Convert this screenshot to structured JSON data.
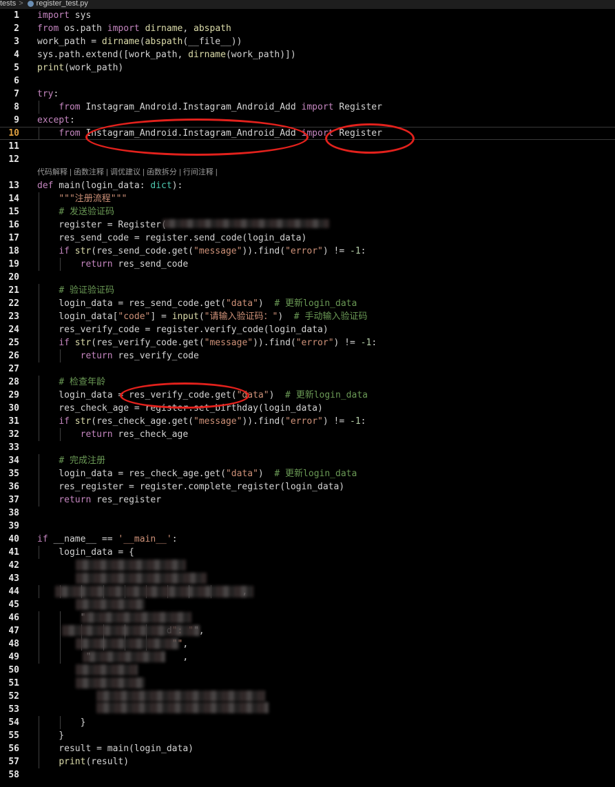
{
  "breadcrumb": {
    "folder": "tests",
    "separator": ">",
    "file": "register_test.py"
  },
  "codelens": "代码解释 | 函数注释 | 调优建议 | 函数拆分 | 行间注释 | ",
  "current_line": 10,
  "lines": [
    {
      "n": "1",
      "code": "import sys"
    },
    {
      "n": "2",
      "code": "from os.path import dirname, abspath"
    },
    {
      "n": "3",
      "code": "work_path = dirname(abspath(__file__))"
    },
    {
      "n": "4",
      "code": "sys.path.extend([work_path, dirname(work_path)])"
    },
    {
      "n": "5",
      "code": "print(work_path)"
    },
    {
      "n": "6",
      "code": ""
    },
    {
      "n": "7",
      "code": "try:"
    },
    {
      "n": "8",
      "code": "    from Instagram_Android.Instagram_Android_Add import Register"
    },
    {
      "n": "9",
      "code": "except:"
    },
    {
      "n": "10",
      "code": "    from Instagram_Android.Instagram_Android_Add import Register"
    },
    {
      "n": "11",
      "code": ""
    },
    {
      "n": "12",
      "code": ""
    },
    {
      "n": "13",
      "code": "def main(login_data: dict):"
    },
    {
      "n": "14",
      "code": "    \"\"\"注册流程\"\"\""
    },
    {
      "n": "15",
      "code": "    # 发送验证码"
    },
    {
      "n": "16",
      "code": "    register = Register("
    },
    {
      "n": "17",
      "code": "    res_send_code = register.send_code(login_data)"
    },
    {
      "n": "18",
      "code": "    if str(res_send_code.get(\"message\")).find(\"error\") != -1:"
    },
    {
      "n": "19",
      "code": "        return res_send_code"
    },
    {
      "n": "20",
      "code": ""
    },
    {
      "n": "21",
      "code": "    # 验证验证码"
    },
    {
      "n": "22",
      "code": "    login_data = res_send_code.get(\"data\")  # 更新login_data"
    },
    {
      "n": "23",
      "code": "    login_data[\"code\"] = input(\"请输入验证码：\")  # 手动输入验证码"
    },
    {
      "n": "24",
      "code": "    res_verify_code = register.verify_code(login_data)"
    },
    {
      "n": "25",
      "code": "    if str(res_verify_code.get(\"message\")).find(\"error\") != -1:"
    },
    {
      "n": "26",
      "code": "        return res_verify_code"
    },
    {
      "n": "27",
      "code": ""
    },
    {
      "n": "28",
      "code": "    # 检查年龄"
    },
    {
      "n": "29",
      "code": "    login_data = res_verify_code.get(\"data\")  # 更新login_data"
    },
    {
      "n": "30",
      "code": "    res_check_age = register.set_birthday(login_data)"
    },
    {
      "n": "31",
      "code": "    if str(res_check_age.get(\"message\")).find(\"error\") != -1:"
    },
    {
      "n": "32",
      "code": "        return res_check_age"
    },
    {
      "n": "33",
      "code": ""
    },
    {
      "n": "34",
      "code": "    # 完成注册"
    },
    {
      "n": "35",
      "code": "    login_data = res_check_age.get(\"data\")  # 更新login_data"
    },
    {
      "n": "36",
      "code": "    res_register = register.complete_register(login_data)"
    },
    {
      "n": "37",
      "code": "    return res_register"
    },
    {
      "n": "38",
      "code": ""
    },
    {
      "n": "39",
      "code": ""
    },
    {
      "n": "40",
      "code": "if __name__ == '__main__':"
    },
    {
      "n": "41",
      "code": "    login_data = {"
    },
    {
      "n": "42",
      "code": ""
    },
    {
      "n": "43",
      "code": ""
    },
    {
      "n": "44",
      "code": "                                      ,"
    },
    {
      "n": "45",
      "code": ""
    },
    {
      "n": "46",
      "code": "        \""
    },
    {
      "n": "47",
      "code": "                        d\": \"\","
    },
    {
      "n": "48",
      "code": "                         \"\","
    },
    {
      "n": "49",
      "code": "         \"                 ,"
    },
    {
      "n": "50",
      "code": ""
    },
    {
      "n": "51",
      "code": ""
    },
    {
      "n": "52",
      "code": ""
    },
    {
      "n": "53",
      "code": ""
    },
    {
      "n": "54",
      "code": "        }"
    },
    {
      "n": "55",
      "code": "    }"
    },
    {
      "n": "56",
      "code": "    result = main(login_data)"
    },
    {
      "n": "57",
      "code": "    print(result)"
    },
    {
      "n": "58",
      "code": ""
    }
  ],
  "colors": {
    "keyword": "#c586c0",
    "string": "#ce9178",
    "comment": "#6a9955",
    "function": "#dcdcaa",
    "annotation_circle": "#e2211c"
  }
}
